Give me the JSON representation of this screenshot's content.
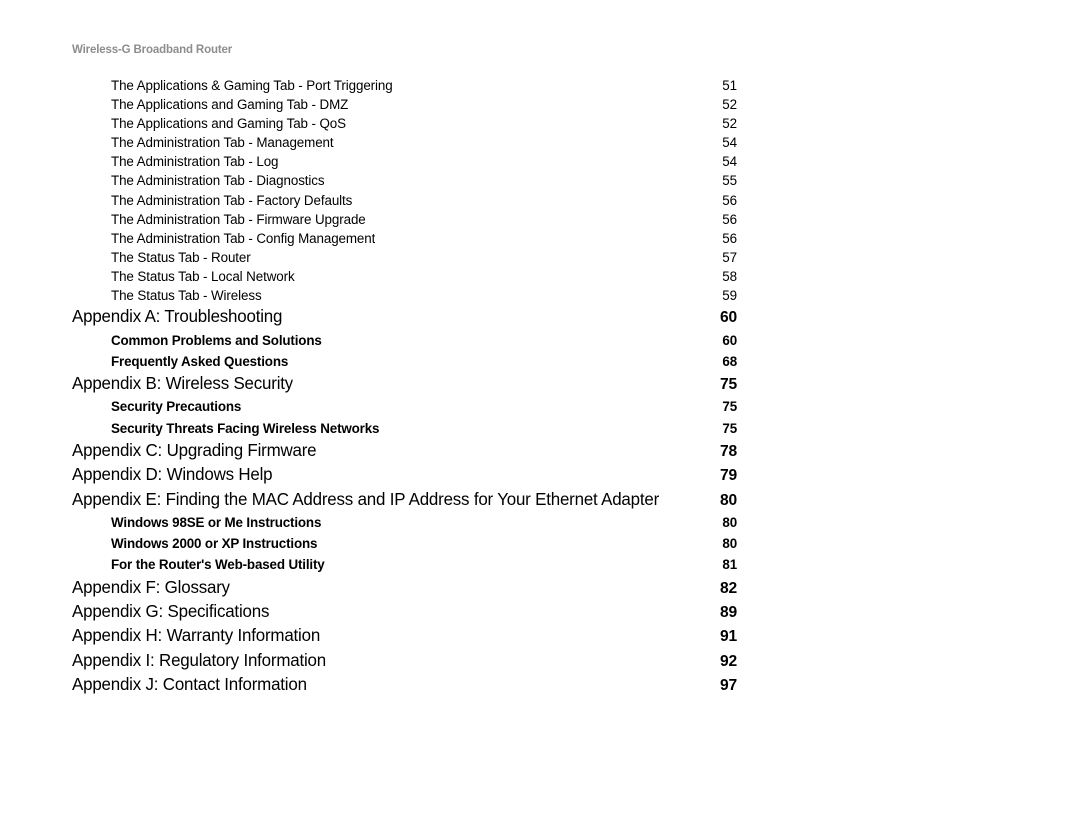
{
  "header": {
    "running_title": "Wireless-G Broadband Router",
    "color": "#8d8d8d"
  },
  "toc": {
    "entries": [
      {
        "level": "sub",
        "title": "The Applications & Gaming Tab - Port Triggering",
        "page": "51"
      },
      {
        "level": "sub",
        "title": "The Applications and Gaming Tab - DMZ",
        "page": "52"
      },
      {
        "level": "sub",
        "title": "The Applications and Gaming Tab - QoS",
        "page": "52"
      },
      {
        "level": "sub",
        "title": "The Administration Tab - Management",
        "page": "54"
      },
      {
        "level": "sub",
        "title": "The Administration Tab - Log",
        "page": "54"
      },
      {
        "level": "sub",
        "title": "The Administration Tab - Diagnostics",
        "page": "55"
      },
      {
        "level": "sub",
        "title": "The Administration Tab - Factory Defaults",
        "page": "56"
      },
      {
        "level": "sub",
        "title": "The Administration Tab - Firmware Upgrade",
        "page": "56"
      },
      {
        "level": "sub",
        "title": "The Administration Tab - Config Management",
        "page": "56"
      },
      {
        "level": "sub",
        "title": "The Status Tab - Router",
        "page": "57"
      },
      {
        "level": "sub",
        "title": "The Status Tab - Local Network",
        "page": "58"
      },
      {
        "level": "sub",
        "title": "The Status Tab - Wireless",
        "page": "59"
      },
      {
        "level": "appendix",
        "title": "Appendix A: Troubleshooting",
        "page": "60"
      },
      {
        "level": "subbold",
        "title": "Common Problems and Solutions",
        "page": "60"
      },
      {
        "level": "subbold",
        "title": "Frequently Asked Questions",
        "page": "68"
      },
      {
        "level": "appendix",
        "title": "Appendix B: Wireless Security",
        "page": "75"
      },
      {
        "level": "subbold",
        "title": "Security Precautions",
        "page": "75"
      },
      {
        "level": "subbold",
        "title": "Security Threats Facing Wireless Networks",
        "page": "75"
      },
      {
        "level": "appendix",
        "title": "Appendix C: Upgrading Firmware",
        "page": "78"
      },
      {
        "level": "appendix",
        "title": "Appendix D: Windows Help",
        "page": "79"
      },
      {
        "level": "appendix",
        "title": "Appendix E: Finding the MAC Address and IP Address for Your Ethernet Adapter",
        "page": "80"
      },
      {
        "level": "subbold",
        "title": "Windows 98SE or Me Instructions",
        "page": "80"
      },
      {
        "level": "subbold",
        "title": "Windows 2000 or XP Instructions",
        "page": "80"
      },
      {
        "level": "subbold",
        "title": "For the Router's Web-based Utility",
        "page": "81"
      },
      {
        "level": "appendix",
        "title": "Appendix F: Glossary",
        "page": "82"
      },
      {
        "level": "appendix",
        "title": "Appendix G: Specifications",
        "page": "89"
      },
      {
        "level": "appendix",
        "title": "Appendix H: Warranty Information",
        "page": "91"
      },
      {
        "level": "appendix",
        "title": "Appendix I: Regulatory Information",
        "page": "92"
      },
      {
        "level": "appendix",
        "title": "Appendix J: Contact Information",
        "page": "97"
      }
    ]
  }
}
